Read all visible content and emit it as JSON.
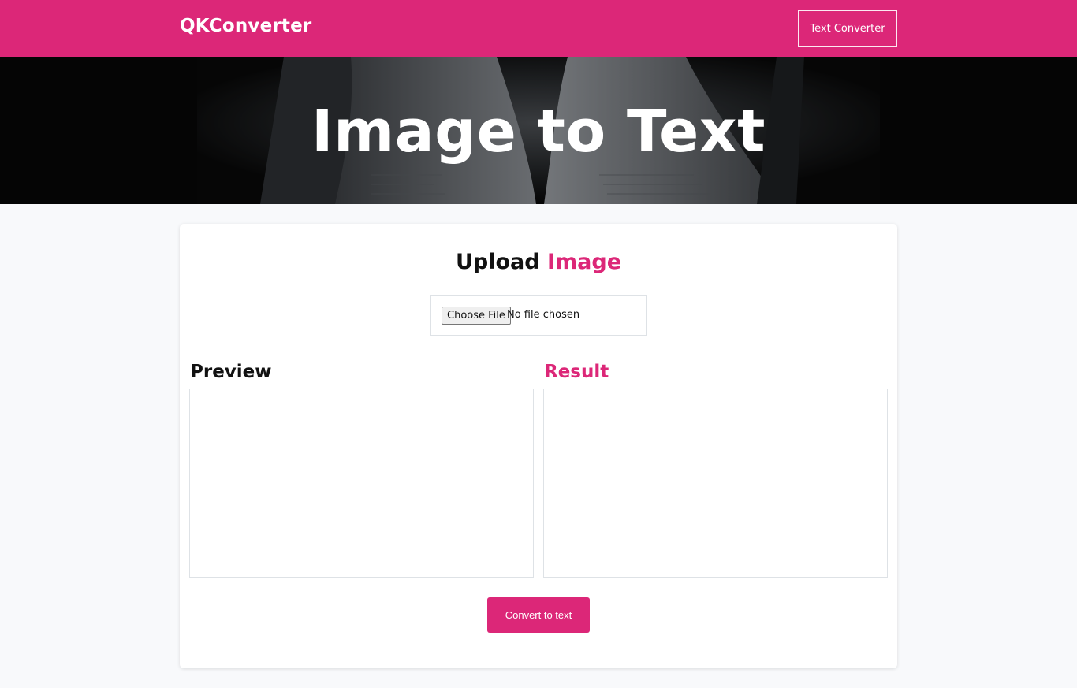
{
  "navbar": {
    "brand": "QKConverter",
    "nav_button_label": "Text Converter"
  },
  "hero": {
    "title": "Image to Text"
  },
  "upload": {
    "title_plain": "Upload",
    "title_accent": "Image",
    "choose_file_label": "Choose File",
    "file_status": "No file chosen"
  },
  "panels": {
    "preview_label": "Preview",
    "result_label": "Result",
    "result_value": ""
  },
  "actions": {
    "convert_label": "Convert to text"
  },
  "colors": {
    "accent": "#dc2778",
    "page_background": "#f8f9fb",
    "card_background": "#ffffff",
    "border": "#dee2e6"
  }
}
